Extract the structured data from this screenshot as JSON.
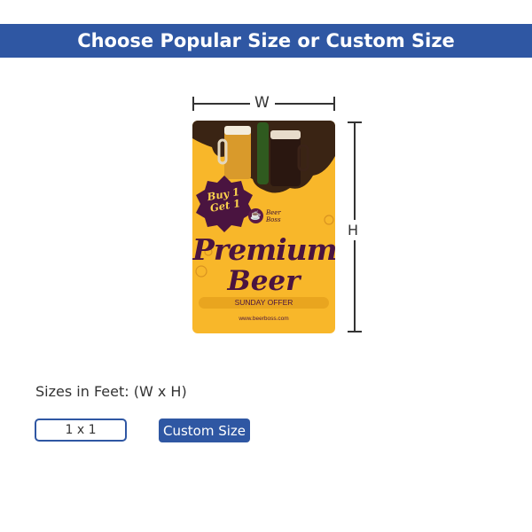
{
  "header": {
    "title": "Choose Popular Size or Custom Size"
  },
  "diagram": {
    "width_label": "W",
    "height_label": "H"
  },
  "poster": {
    "badge_line1": "Buy 1",
    "badge_line2": "Get 1",
    "brand_line1": "Beer",
    "brand_line2": "Boss",
    "title_line1": "Premium",
    "title_line2": "Beer",
    "offer": "SUNDAY OFFER",
    "website": "www.beerboss.com",
    "colors": {
      "background": "#f8b72a",
      "accent": "#4a1440"
    }
  },
  "sizes": {
    "label": "Sizes in Feet: (W x H)",
    "options": [
      "1 x 1"
    ],
    "custom_label": "Custom Size"
  },
  "colors": {
    "brand": "#2f57a3"
  }
}
